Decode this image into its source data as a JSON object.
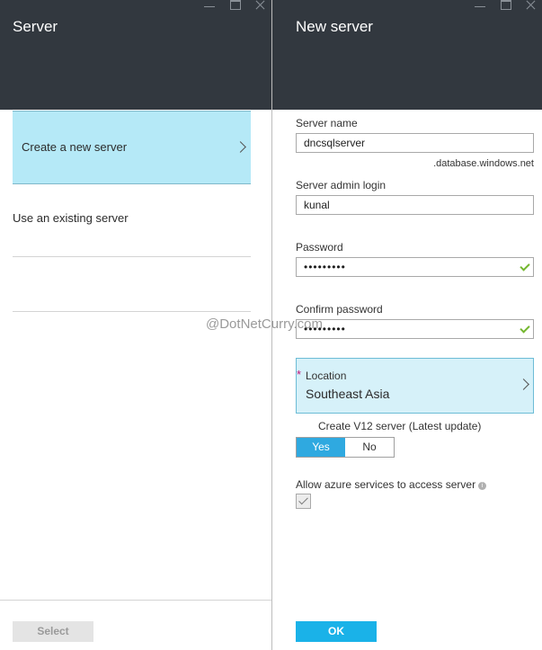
{
  "server_blade": {
    "title": "Server",
    "options": [
      {
        "label": "Create a new server",
        "selected": true
      },
      {
        "label": "Use an existing server",
        "selected": false
      },
      {
        "label": "",
        "selected": false
      }
    ],
    "select_button": "Select"
  },
  "new_server_blade": {
    "title": "New server",
    "server_name": {
      "label": "Server name",
      "value": "dncsqlserver",
      "suffix": ".database.windows.net"
    },
    "admin_login": {
      "label": "Server admin login",
      "value": "kunal"
    },
    "password": {
      "label": "Password",
      "value": "•••••••••",
      "valid": true
    },
    "confirm_password": {
      "label": "Confirm password",
      "value": "•••••••••",
      "valid": true
    },
    "location": {
      "required_marker": "*",
      "label": "Location",
      "value": "Southeast Asia"
    },
    "v12": {
      "label": "Create V12 server (Latest update)",
      "yes": "Yes",
      "no": "No",
      "selected": "Yes"
    },
    "allow_azure": {
      "label": "Allow azure services to access server",
      "checked": true
    },
    "ok_button": "OK"
  },
  "window_controls": {
    "icons": [
      "minimize-icon",
      "maximize-icon",
      "close-icon"
    ]
  },
  "watermark": "@DotNetCurry.com",
  "colors": {
    "header": "#32383f",
    "selected": "#b5e9f7",
    "accent": "#1ab2e8",
    "valid": "#74b72f",
    "required": "#c0157a"
  }
}
